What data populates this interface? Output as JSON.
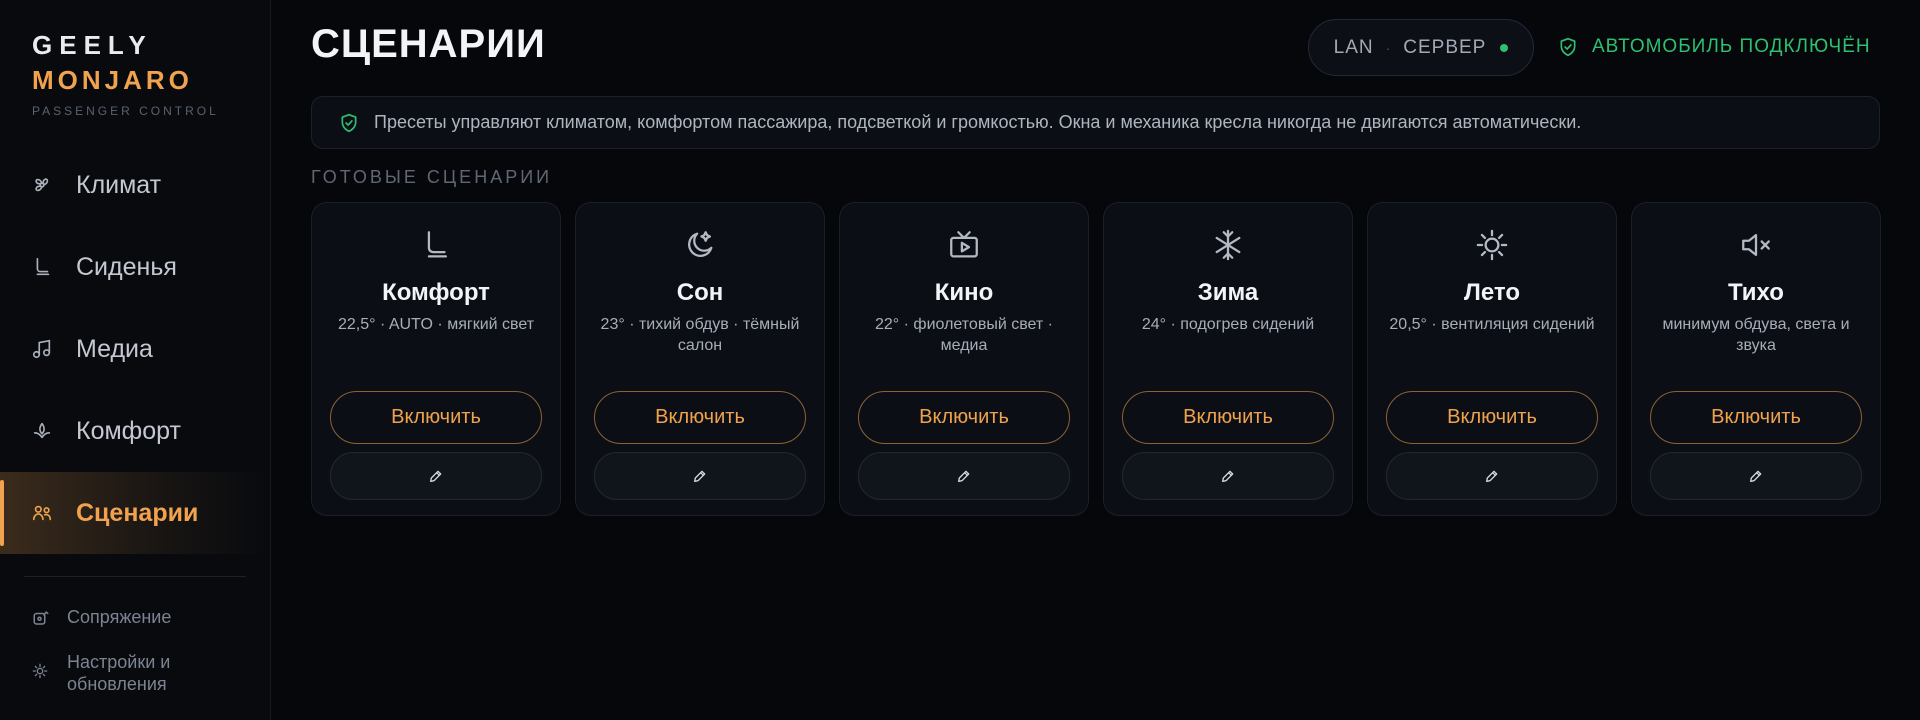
{
  "brand": {
    "line1": "GEELY",
    "line2": "MONJARO",
    "line3": "PASSENGER CONTROL"
  },
  "nav": [
    {
      "label": "Климат",
      "icon": "climate-fan-icon"
    },
    {
      "label": "Сиденья",
      "icon": "seat-icon"
    },
    {
      "label": "Медиа",
      "icon": "music-note-icon"
    },
    {
      "label": "Комфорт",
      "icon": "comfort-icon"
    },
    {
      "label": "Сценарии",
      "icon": "people-icon",
      "active": true
    }
  ],
  "sub_nav": [
    {
      "label": "Сопряжение",
      "icon": "pairing-icon"
    },
    {
      "label": "Настройки и обновления",
      "icon": "settings-sun-icon"
    }
  ],
  "header": {
    "title": "СЦЕНАРИИ",
    "connection": {
      "lan": "LAN",
      "separator": "·",
      "server": "СЕРВЕР"
    },
    "car_status": "АВТОМОБИЛЬ ПОДКЛЮЧЁН"
  },
  "banner": {
    "text": "Пресеты управляют климатом, комфортом пассажира, подсветкой и громкостью. Окна и механика кресла никогда не двигаются автоматически."
  },
  "section_label": "ГОТОВЫЕ СЦЕНАРИИ",
  "scenarios": [
    {
      "title": "Комфорт",
      "subtitle": "22,5° · AUTO · мягкий свет",
      "button": "Включить",
      "icon": "seat-icon"
    },
    {
      "title": "Сон",
      "subtitle": "23° · тихий обдув · тёмный салон",
      "button": "Включить",
      "icon": "moon-icon"
    },
    {
      "title": "Кино",
      "subtitle": "22° · фиолетовый свет · медиа",
      "button": "Включить",
      "icon": "tv-play-icon"
    },
    {
      "title": "Зима",
      "subtitle": "24° · подогрев сидений",
      "button": "Включить",
      "icon": "snowflake-icon"
    },
    {
      "title": "Лето",
      "subtitle": "20,5° · вентиляция сидений",
      "button": "Включить",
      "icon": "sun-icon"
    },
    {
      "title": "Тихо",
      "subtitle": "минимум обдува, света и звука",
      "button": "Включить",
      "icon": "mute-icon"
    }
  ],
  "colors": {
    "accent": "#f0a24e",
    "ok": "#2fbf71",
    "bg": "#05070b"
  }
}
